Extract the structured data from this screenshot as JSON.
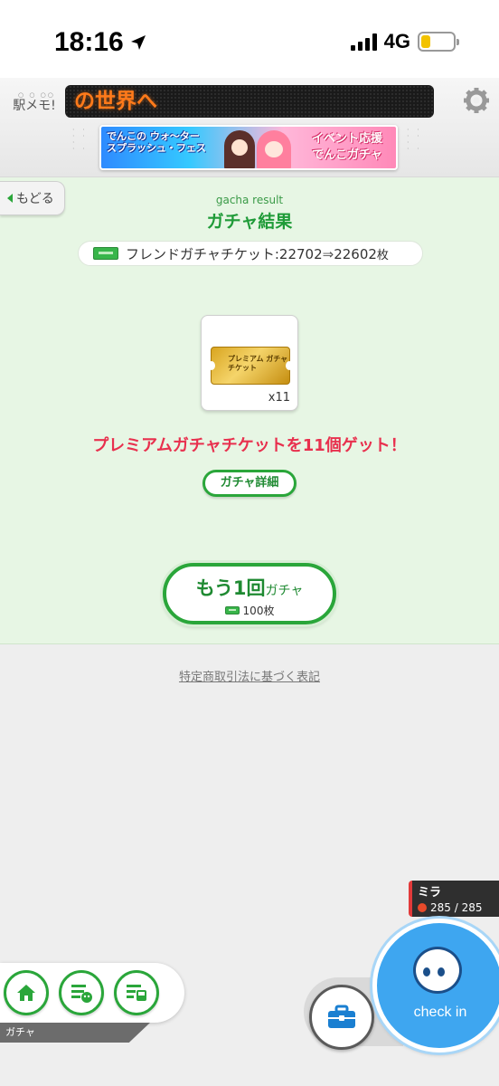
{
  "status_bar": {
    "time": "18:16",
    "network": "4G",
    "battery_level": 0.28
  },
  "header": {
    "logo_text": "駅メモ!",
    "led_text": "の世界へ",
    "banner": {
      "left_text": "でんこの ウォ〜ター スプラッシュ・フェス",
      "right_text_line1": "イベント応援",
      "right_text_line2": "でんこガチャ"
    }
  },
  "main": {
    "back_label": "もどる",
    "subtitle": "gacha result",
    "title": "ガチャ結果",
    "ticket_count": {
      "label": "フレンドガチャチケット:",
      "before": "22702",
      "arrow": "⇒",
      "after": "22602",
      "unit": "枚"
    },
    "reward": {
      "ticket_text": "プレミアム ガチャチケット",
      "quantity": "x11"
    },
    "result_message": "プレミアムガチャチケットを11個ゲット！",
    "detail_button": "ガチャ詳細",
    "again_button": {
      "main": "もう1回",
      "suffix": "ガチャ",
      "cost": "100枚"
    }
  },
  "legal_link": "特定商取引法に基づく表記",
  "bottom": {
    "nav_label": "ガチャ",
    "character": {
      "name": "ミラ",
      "hp": "285 / 285"
    },
    "checkin_label": "check in"
  },
  "colors": {
    "accent_green": "#2aa63a",
    "result_red": "#e8304e",
    "checkin_blue": "#3ea6f0"
  },
  "icons": [
    "location-arrow-icon",
    "signal-icon",
    "battery-icon",
    "gear-icon",
    "home-icon",
    "list-denko-icon",
    "list-train-icon",
    "briefcase-icon"
  ]
}
